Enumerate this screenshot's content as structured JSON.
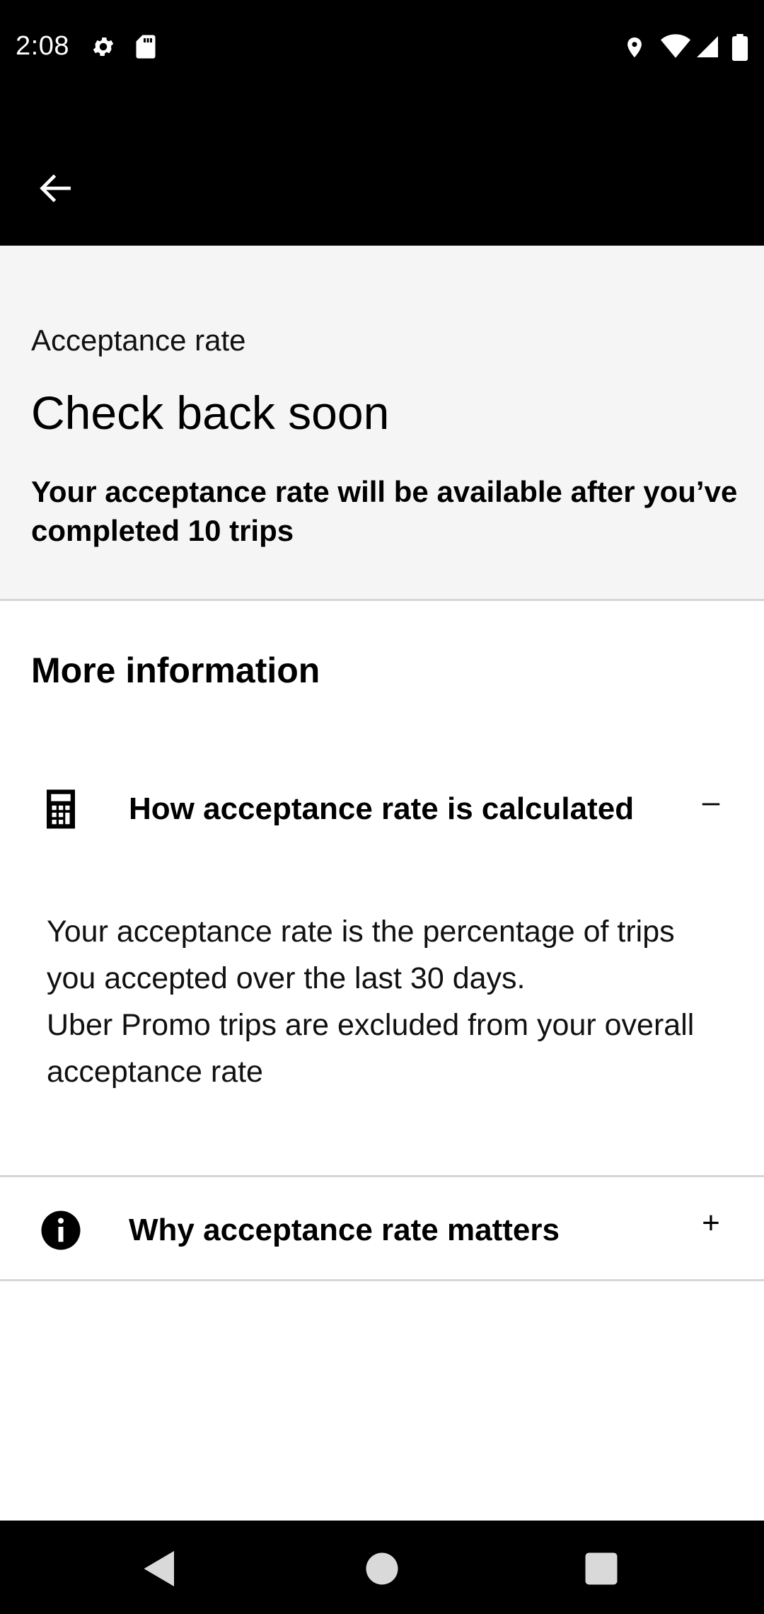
{
  "status_bar": {
    "time": "2:08",
    "icons": [
      "settings-icon",
      "sd-card-icon",
      "location-icon",
      "wifi-icon",
      "signal-icon",
      "battery-icon"
    ]
  },
  "app_bar": {
    "back_icon": "arrow-left-icon"
  },
  "summary": {
    "label": "Acceptance rate",
    "title": "Check back soon",
    "body": "Your acceptance rate will be available after you’ve completed 10 trips"
  },
  "more_info": {
    "title": "More information",
    "items": [
      {
        "icon": "calculator-icon",
        "label": "How acceptance rate is calculated",
        "toggle": "–",
        "expanded": true,
        "content": [
          "Your acceptance rate is the percentage of trips you accepted over the last 30 days.",
          "Uber Promo trips are excluded from your overall acceptance rate"
        ]
      },
      {
        "icon": "info-icon",
        "label": "Why acceptance rate matters",
        "toggle": "+",
        "expanded": false
      }
    ]
  },
  "nav_bar": {
    "buttons": [
      "back-triangle-icon",
      "home-circle-icon",
      "recents-square-icon"
    ]
  },
  "colors": {
    "header_bg": "#000000",
    "summary_bg": "#f5f5f5",
    "divider": "#d6d6d6"
  }
}
